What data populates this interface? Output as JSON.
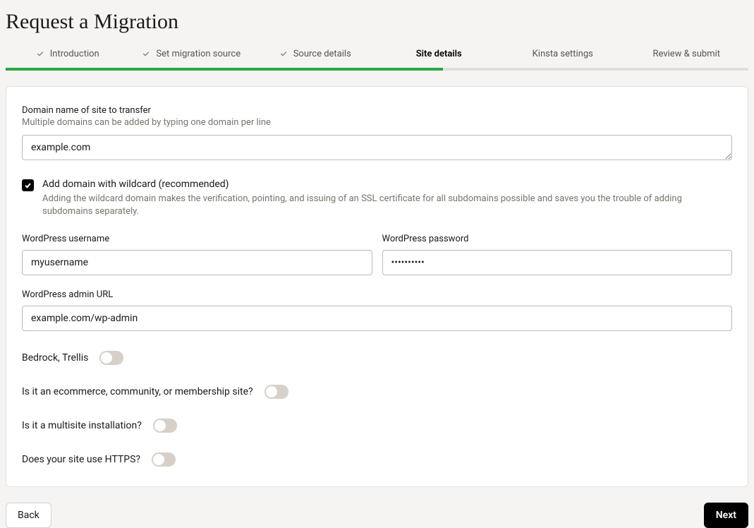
{
  "page_title": "Request a Migration",
  "steps": [
    {
      "label": "Introduction",
      "completed": true,
      "active": false
    },
    {
      "label": "Set migration source",
      "completed": true,
      "active": false
    },
    {
      "label": "Source details",
      "completed": true,
      "active": false
    },
    {
      "label": "Site details",
      "completed": false,
      "active": true
    },
    {
      "label": "Kinsta settings",
      "completed": false,
      "active": false
    },
    {
      "label": "Review & submit",
      "completed": false,
      "active": false
    }
  ],
  "domain_field": {
    "label": "Domain name of site to transfer",
    "sublabel": "Multiple domains can be added by typing one domain per line",
    "value": "example.com"
  },
  "wildcard_checkbox": {
    "checked": true,
    "label": "Add domain with wildcard (recommended)",
    "description": "Adding the wildcard domain makes the verification, pointing, and issuing of an SSL certificate for all subdomains possible and saves you the trouble of adding subdomains separately."
  },
  "wp_username": {
    "label": "WordPress username",
    "value": "myusername"
  },
  "wp_password": {
    "label": "WordPress password",
    "value": "••••••••••"
  },
  "wp_admin_url": {
    "label": "WordPress admin URL",
    "value": "example.com/wp-admin"
  },
  "toggles": {
    "bedrock": {
      "label": "Bedrock, Trellis",
      "on": false
    },
    "ecommerce": {
      "label": "Is it an ecommerce, community, or membership site?",
      "on": false
    },
    "multisite": {
      "label": "Is it a multisite installation?",
      "on": false
    },
    "https": {
      "label": "Does your site use HTTPS?",
      "on": false
    }
  },
  "buttons": {
    "back": "Back",
    "next": "Next"
  }
}
